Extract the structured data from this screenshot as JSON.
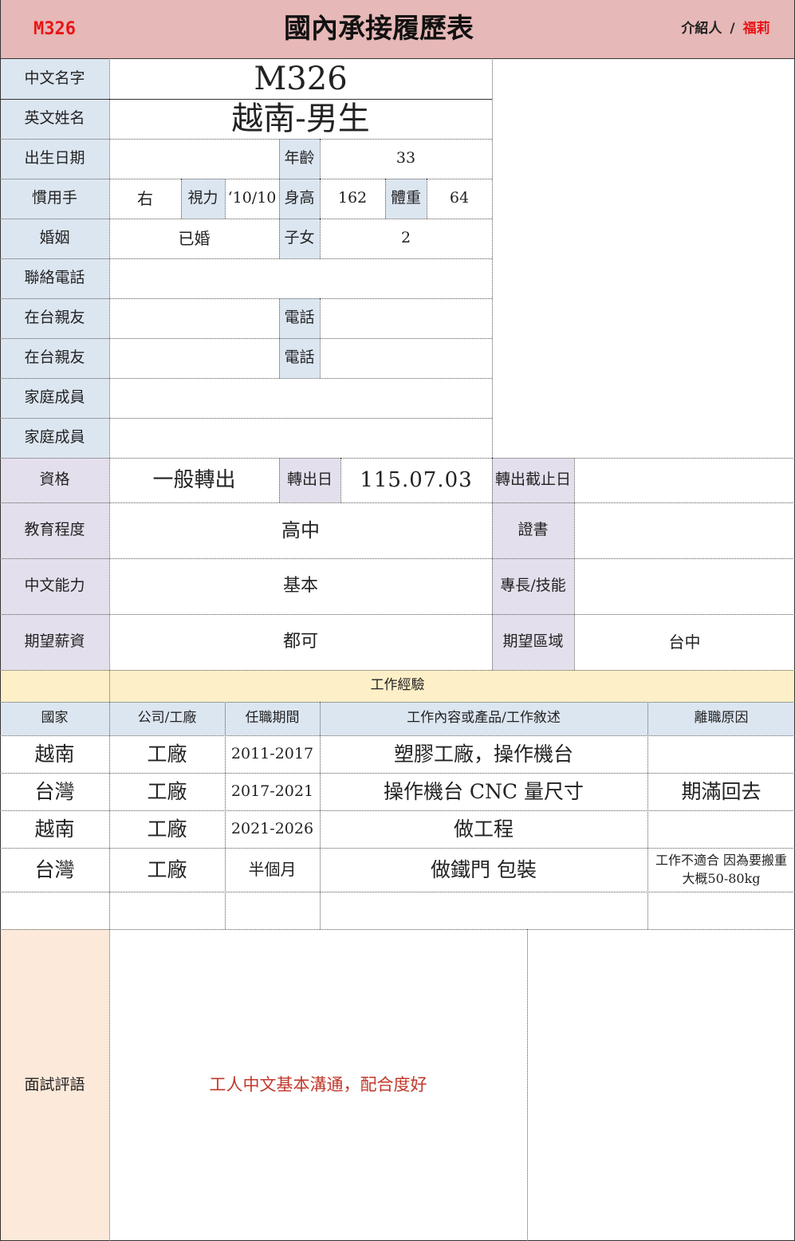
{
  "header": {
    "code": "M326",
    "title": "國內承接履歷表",
    "introducer_label": "介紹人",
    "separator": "/",
    "introducer_name": "福莉"
  },
  "labels": {
    "chinese_name": "中文名字",
    "english_name": "英文姓名",
    "birth_date": "出生日期",
    "age": "年齡",
    "handedness": "慣用手",
    "vision": "視力",
    "height": "身高",
    "weight": "體重",
    "marriage": "婚姻",
    "children": "子女",
    "phone": "聯絡電話",
    "relative1": "在台親友",
    "relative1_phone": "電話",
    "relative2": "在台親友",
    "relative2_phone": "電話",
    "family1": "家庭成員",
    "family2": "家庭成員",
    "qualification": "資格",
    "transfer_date": "轉出日",
    "transfer_deadline": "轉出截止日",
    "education": "教育程度",
    "certificate": "證書",
    "chinese_ability": "中文能力",
    "specialty": "專長/技能",
    "expected_salary": "期望薪資",
    "expected_region": "期望區域",
    "interview_comment": "面試評語"
  },
  "values": {
    "chinese_name": "M326",
    "english_name": "越南-男生",
    "birth_date": "",
    "age": "33",
    "handedness": "右",
    "vision": "‘10/10",
    "height": "162",
    "weight": "64",
    "marriage": "已婚",
    "children": "2",
    "phone": "",
    "qualification": "一般轉出",
    "transfer_date": "115.07.03",
    "transfer_deadline": "",
    "education": "高中",
    "certificate": "",
    "chinese_ability": "基本",
    "specialty": "",
    "expected_salary": "都可",
    "expected_region": "台中",
    "interview_comment": "工人中文基本溝通，配合度好"
  },
  "work": {
    "title": "工作經驗",
    "headers": [
      "國家",
      "公司/工廠",
      "任職期間",
      "工作內容或產品/工作敘述",
      "離職原因"
    ],
    "rows": [
      [
        "越南",
        "工廠",
        "2011-2017",
        "塑膠工廠，操作機台",
        ""
      ],
      [
        "台灣",
        "工廠",
        "2017-2021",
        "操作機台 CNC 量尺寸",
        "期滿回去"
      ],
      [
        "越南",
        "工廠",
        "2021-2026",
        "做工程",
        ""
      ],
      [
        "台灣",
        "工廠",
        "半個月",
        "做鐵門 包裝",
        "工作不適合 因為要搬重大概50-80kg"
      ],
      [
        "",
        "",
        "",
        "",
        ""
      ]
    ]
  },
  "colors": {
    "header_bg": "#e6b8b7",
    "code_red": "#e81416",
    "label_blue": "#dce6f1",
    "label_lavender": "#e4dfec",
    "work_title_bg": "#fdefc7",
    "comment_bg": "#fce9d9",
    "comment_text": "#c0392b"
  }
}
